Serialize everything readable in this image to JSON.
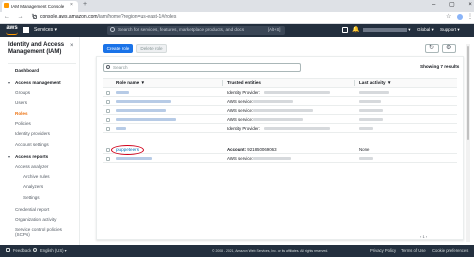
{
  "browser": {
    "tab_title": "IAM Management Console",
    "tab_close": "×",
    "new_tab": "+",
    "window_controls": "– ▢ ×",
    "nav_arrows": "← → ↻",
    "url_host": "console.aws.amazon.com",
    "url_path": "/iam/home?region=us-east-1#/roles",
    "star_icon": "☆",
    "menu_icon": "⋮"
  },
  "aws_nav": {
    "logo": "aws",
    "services_label": "Services ▾",
    "search_placeholder": "Search for services, features, marketplace products, and docs",
    "search_shortcut": "[Alt+S]",
    "bell_icon": "🔔",
    "account_prefix": "▾",
    "region": "Global ▾",
    "support": "Support ▾"
  },
  "sidebar": {
    "title": "Identity and Access Management (IAM)",
    "close_icon": "×",
    "dashboard": "Dashboard",
    "access_management": "Access management",
    "groups": "Groups",
    "users": "Users",
    "roles": "Roles",
    "policies": "Policies",
    "identity_providers": "Identity providers",
    "account_settings": "Account settings",
    "access_reports": "Access reports",
    "access_analyzer": "Access analyzer",
    "archive_rules": "Archive rules",
    "analyzers": "Analyzers",
    "settings": "Settings",
    "credential_report": "Credential report",
    "organization_activity": "Organization activity",
    "service_control_policies": "Service control policies (SCPs)",
    "caret_down": "▾"
  },
  "toolbar": {
    "create_role": "Create role",
    "delete_role": "Delete role",
    "refresh_icon": "↻",
    "settings_icon": "⚙"
  },
  "table": {
    "filter_placeholder": "Search",
    "showing": "Showing 7 results",
    "columns": [
      "Role name ▼",
      "Trusted entities",
      "Last activity ▼"
    ],
    "rows": [
      {
        "name_blurred": true,
        "trusted": "Identity Provider:",
        "activity_blurred": true
      },
      {
        "name_blurred": true,
        "trusted": "AWS service:",
        "activity_blurred": true
      },
      {
        "name_blurred": true,
        "trusted": "AWS service:",
        "activity_blurred": true
      },
      {
        "name_blurred": true,
        "trusted": "AWS service:",
        "activity_blurred": true
      },
      {
        "name_blurred": true,
        "trusted": "Identity Provider:",
        "activity_blurred": true
      },
      {
        "name": "puppeteers",
        "trusted_label": "Account:",
        "trusted_value": "921850069063",
        "activity": "None",
        "highlighted": true
      },
      {
        "name_blurred": true,
        "trusted": "AWS service:",
        "activity_blurred": true
      }
    ],
    "pagination": "‹ 1 ›"
  },
  "footer": {
    "feedback": "Feedback",
    "language": "English (US) ▾",
    "copyright": "© 2008 - 2021, Amazon Web Services, Inc. or its affiliates. All rights reserved.",
    "privacy": "Privacy Policy",
    "terms": "Terms of Use",
    "cookie": "Cookie preferences"
  },
  "colors": {
    "aws_nav_bg": "#232f3e",
    "accent_orange": "#ec7211",
    "primary_blue": "#1a73e8",
    "link_blue": "#0073bb",
    "highlight_red": "#d0021b"
  }
}
